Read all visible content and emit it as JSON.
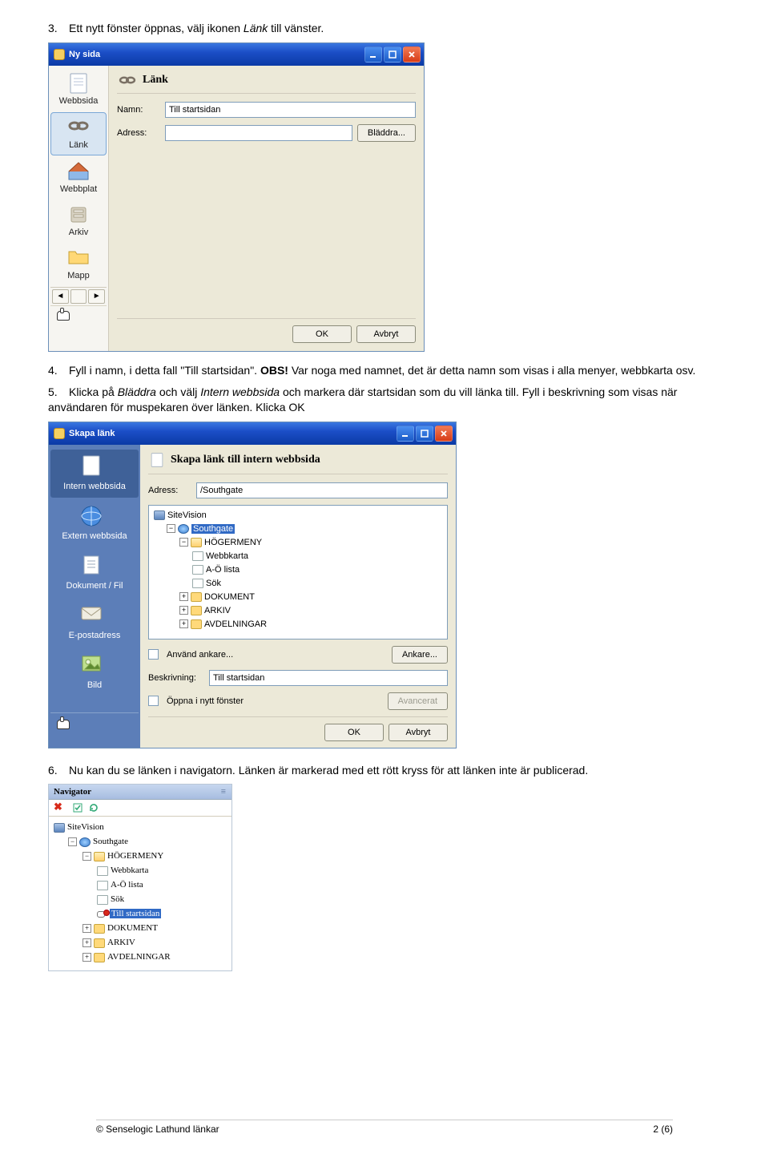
{
  "steps": {
    "s3": {
      "num": "3.",
      "text_a": "Ett nytt fönster öppnas, välj ikonen ",
      "italic": "Länk",
      "text_b": " till vänster."
    },
    "s4": {
      "num": "4.",
      "text_a": "Fyll i namn, i detta fall \"Till startsidan\". ",
      "bold": "OBS!",
      "text_b": " Var noga med namnet, det är detta namn som visas i alla menyer, webbkarta osv."
    },
    "s5": {
      "num": "5.",
      "text_a": "Klicka på ",
      "italic1": "Bläddra",
      "mid": " och välj ",
      "italic2": "Intern webbsida",
      "text_b": " och markera där startsidan som du vill länka till. Fyll i beskrivning som visas när användaren för muspekaren över länken. Klicka OK"
    },
    "s6": {
      "num": "6.",
      "text": "Nu kan du se länken i navigatorn. Länken är markerad med ett rött kryss för att länken inte är publicerad."
    }
  },
  "dialog1": {
    "title": "Ny sida",
    "side": {
      "webbsida": "Webbsida",
      "link": "Länk",
      "webbplat": "Webbplat",
      "arkiv": "Arkiv",
      "mapp": "Mapp"
    },
    "header": "Länk",
    "lbl_name": "Namn:",
    "val_name": "Till startsidan",
    "lbl_adr": "Adress:",
    "btn_browse": "Bläddra...",
    "btn_ok": "OK",
    "btn_cancel": "Avbryt"
  },
  "dialog2": {
    "title": "Skapa länk",
    "side": {
      "intern": "Intern webbsida",
      "extern": "Extern webbsida",
      "doc": "Dokument / Fil",
      "mail": "E-postadress",
      "pic": "Bild"
    },
    "header": "Skapa länk till intern webbsida",
    "lbl_adr": "Adress:",
    "val_adr": "/Southgate",
    "tree": {
      "root": "SiteVision",
      "southgate": "Southgate",
      "hogermeny": "HÖGERMENY",
      "webbkarta": "Webbkarta",
      "aolista": "A-Ö lista",
      "sok": "Sök",
      "dokument": "DOKUMENT",
      "arkiv": "ARKIV",
      "avdel": "AVDELNINGAR"
    },
    "chk_anchor": "Använd ankare...",
    "btn_anchor": "Ankare...",
    "lbl_desc": "Beskrivning:",
    "val_desc": "Till startsidan",
    "chk_newwin": "Öppna i nytt fönster",
    "btn_adv": "Avancerat",
    "btn_ok": "OK",
    "btn_cancel": "Avbryt"
  },
  "nav": {
    "title": "Navigator",
    "tree": {
      "root": "SiteVision",
      "southgate": "Southgate",
      "hogermeny": "HÖGERMENY",
      "webbkarta": "Webbkarta",
      "aolista": "A-Ö lista",
      "sok": "Sök",
      "startlink": "Till startsidan",
      "dokument": "DOKUMENT",
      "arkiv": "ARKIV",
      "avdel": "AVDELNINGAR"
    }
  },
  "footer": {
    "left": "© Senselogic Lathund länkar",
    "right": "2 (6)"
  }
}
